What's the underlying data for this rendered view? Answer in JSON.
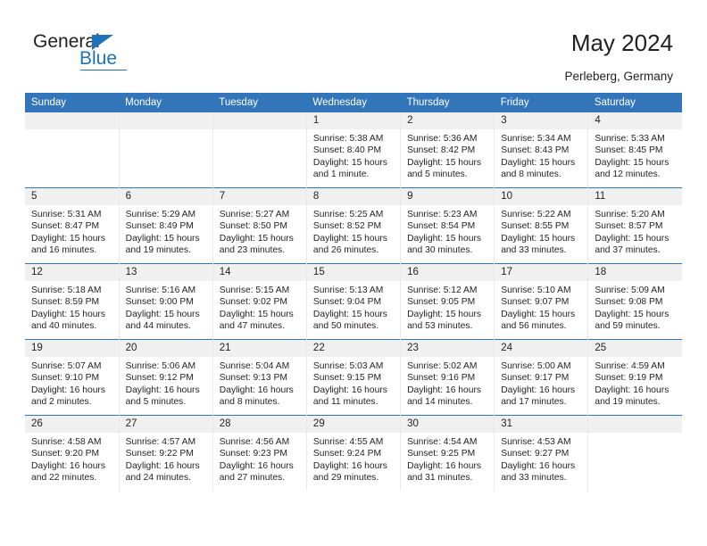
{
  "logo": {
    "word_top": "General",
    "word_bottom": "Blue",
    "triangle_color": "#1f72b8"
  },
  "header": {
    "title": "May 2024",
    "location": "Perleberg, Germany"
  },
  "colors": {
    "header_band": "#3275b8",
    "daynum_band": "#f0f0f0",
    "row_divider": "#3275b8"
  },
  "calendar": {
    "weekday_headers": [
      "Sunday",
      "Monday",
      "Tuesday",
      "Wednesday",
      "Thursday",
      "Friday",
      "Saturday"
    ],
    "labels": {
      "sunrise_prefix": "Sunrise:",
      "sunset_prefix": "Sunset:",
      "daylight_prefix": "Daylight:"
    },
    "weeks": [
      [
        {
          "day": "",
          "empty": true
        },
        {
          "day": "",
          "empty": true
        },
        {
          "day": "",
          "empty": true
        },
        {
          "day": "1",
          "sunrise": "Sunrise: 5:38 AM",
          "sunset": "Sunset: 8:40 PM",
          "daylight": "Daylight: 15 hours and 1 minute."
        },
        {
          "day": "2",
          "sunrise": "Sunrise: 5:36 AM",
          "sunset": "Sunset: 8:42 PM",
          "daylight": "Daylight: 15 hours and 5 minutes."
        },
        {
          "day": "3",
          "sunrise": "Sunrise: 5:34 AM",
          "sunset": "Sunset: 8:43 PM",
          "daylight": "Daylight: 15 hours and 8 minutes."
        },
        {
          "day": "4",
          "sunrise": "Sunrise: 5:33 AM",
          "sunset": "Sunset: 8:45 PM",
          "daylight": "Daylight: 15 hours and 12 minutes."
        }
      ],
      [
        {
          "day": "5",
          "sunrise": "Sunrise: 5:31 AM",
          "sunset": "Sunset: 8:47 PM",
          "daylight": "Daylight: 15 hours and 16 minutes."
        },
        {
          "day": "6",
          "sunrise": "Sunrise: 5:29 AM",
          "sunset": "Sunset: 8:49 PM",
          "daylight": "Daylight: 15 hours and 19 minutes."
        },
        {
          "day": "7",
          "sunrise": "Sunrise: 5:27 AM",
          "sunset": "Sunset: 8:50 PM",
          "daylight": "Daylight: 15 hours and 23 minutes."
        },
        {
          "day": "8",
          "sunrise": "Sunrise: 5:25 AM",
          "sunset": "Sunset: 8:52 PM",
          "daylight": "Daylight: 15 hours and 26 minutes."
        },
        {
          "day": "9",
          "sunrise": "Sunrise: 5:23 AM",
          "sunset": "Sunset: 8:54 PM",
          "daylight": "Daylight: 15 hours and 30 minutes."
        },
        {
          "day": "10",
          "sunrise": "Sunrise: 5:22 AM",
          "sunset": "Sunset: 8:55 PM",
          "daylight": "Daylight: 15 hours and 33 minutes."
        },
        {
          "day": "11",
          "sunrise": "Sunrise: 5:20 AM",
          "sunset": "Sunset: 8:57 PM",
          "daylight": "Daylight: 15 hours and 37 minutes."
        }
      ],
      [
        {
          "day": "12",
          "sunrise": "Sunrise: 5:18 AM",
          "sunset": "Sunset: 8:59 PM",
          "daylight": "Daylight: 15 hours and 40 minutes."
        },
        {
          "day": "13",
          "sunrise": "Sunrise: 5:16 AM",
          "sunset": "Sunset: 9:00 PM",
          "daylight": "Daylight: 15 hours and 44 minutes."
        },
        {
          "day": "14",
          "sunrise": "Sunrise: 5:15 AM",
          "sunset": "Sunset: 9:02 PM",
          "daylight": "Daylight: 15 hours and 47 minutes."
        },
        {
          "day": "15",
          "sunrise": "Sunrise: 5:13 AM",
          "sunset": "Sunset: 9:04 PM",
          "daylight": "Daylight: 15 hours and 50 minutes."
        },
        {
          "day": "16",
          "sunrise": "Sunrise: 5:12 AM",
          "sunset": "Sunset: 9:05 PM",
          "daylight": "Daylight: 15 hours and 53 minutes."
        },
        {
          "day": "17",
          "sunrise": "Sunrise: 5:10 AM",
          "sunset": "Sunset: 9:07 PM",
          "daylight": "Daylight: 15 hours and 56 minutes."
        },
        {
          "day": "18",
          "sunrise": "Sunrise: 5:09 AM",
          "sunset": "Sunset: 9:08 PM",
          "daylight": "Daylight: 15 hours and 59 minutes."
        }
      ],
      [
        {
          "day": "19",
          "sunrise": "Sunrise: 5:07 AM",
          "sunset": "Sunset: 9:10 PM",
          "daylight": "Daylight: 16 hours and 2 minutes."
        },
        {
          "day": "20",
          "sunrise": "Sunrise: 5:06 AM",
          "sunset": "Sunset: 9:12 PM",
          "daylight": "Daylight: 16 hours and 5 minutes."
        },
        {
          "day": "21",
          "sunrise": "Sunrise: 5:04 AM",
          "sunset": "Sunset: 9:13 PM",
          "daylight": "Daylight: 16 hours and 8 minutes."
        },
        {
          "day": "22",
          "sunrise": "Sunrise: 5:03 AM",
          "sunset": "Sunset: 9:15 PM",
          "daylight": "Daylight: 16 hours and 11 minutes."
        },
        {
          "day": "23",
          "sunrise": "Sunrise: 5:02 AM",
          "sunset": "Sunset: 9:16 PM",
          "daylight": "Daylight: 16 hours and 14 minutes."
        },
        {
          "day": "24",
          "sunrise": "Sunrise: 5:00 AM",
          "sunset": "Sunset: 9:17 PM",
          "daylight": "Daylight: 16 hours and 17 minutes."
        },
        {
          "day": "25",
          "sunrise": "Sunrise: 4:59 AM",
          "sunset": "Sunset: 9:19 PM",
          "daylight": "Daylight: 16 hours and 19 minutes."
        }
      ],
      [
        {
          "day": "26",
          "sunrise": "Sunrise: 4:58 AM",
          "sunset": "Sunset: 9:20 PM",
          "daylight": "Daylight: 16 hours and 22 minutes."
        },
        {
          "day": "27",
          "sunrise": "Sunrise: 4:57 AM",
          "sunset": "Sunset: 9:22 PM",
          "daylight": "Daylight: 16 hours and 24 minutes."
        },
        {
          "day": "28",
          "sunrise": "Sunrise: 4:56 AM",
          "sunset": "Sunset: 9:23 PM",
          "daylight": "Daylight: 16 hours and 27 minutes."
        },
        {
          "day": "29",
          "sunrise": "Sunrise: 4:55 AM",
          "sunset": "Sunset: 9:24 PM",
          "daylight": "Daylight: 16 hours and 29 minutes."
        },
        {
          "day": "30",
          "sunrise": "Sunrise: 4:54 AM",
          "sunset": "Sunset: 9:25 PM",
          "daylight": "Daylight: 16 hours and 31 minutes."
        },
        {
          "day": "31",
          "sunrise": "Sunrise: 4:53 AM",
          "sunset": "Sunset: 9:27 PM",
          "daylight": "Daylight: 16 hours and 33 minutes."
        },
        {
          "day": "",
          "empty": true
        }
      ]
    ]
  }
}
